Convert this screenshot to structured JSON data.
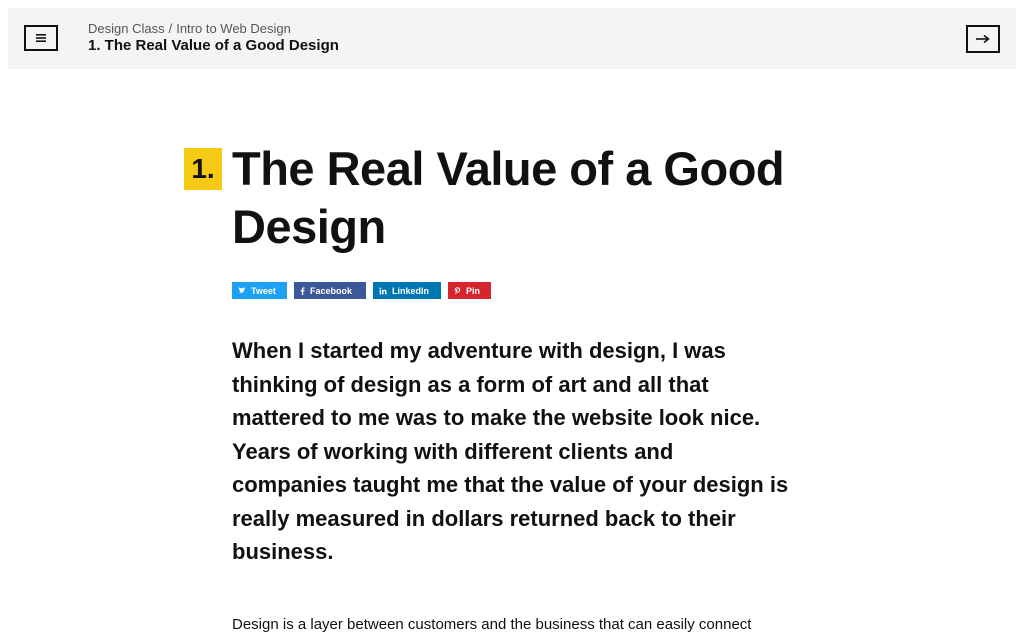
{
  "topbar": {
    "breadcrumb": {
      "course": "Design Class",
      "separator": "/",
      "section": "Intro to Web Design"
    },
    "current_lesson": "1. The Real Value of a Good Design",
    "menu_icon": "menu-icon",
    "next_icon": "arrow-right-icon"
  },
  "article": {
    "number": "1.",
    "title": "The Real Value of a Good Design",
    "share": {
      "tweet": "Tweet",
      "facebook": "Facebook",
      "linkedin": "LinkedIn",
      "pin": "Pin"
    },
    "lead": "When I started my adventure with design, I was thinking of design as a form of art and all that mattered to me was to make the website look nice. Years of working with different clients and companies taught me that the value of your design is really measured in dollars returned back to their business.",
    "body": "Design is a layer between customers and the business that can easily connect"
  },
  "colors": {
    "badge": "#f6c915",
    "topbar_bg": "#f4f4f4",
    "tweet": "#1da1f2",
    "facebook": "#3b5998",
    "linkedin": "#0077b5",
    "pin": "#d7252d"
  }
}
